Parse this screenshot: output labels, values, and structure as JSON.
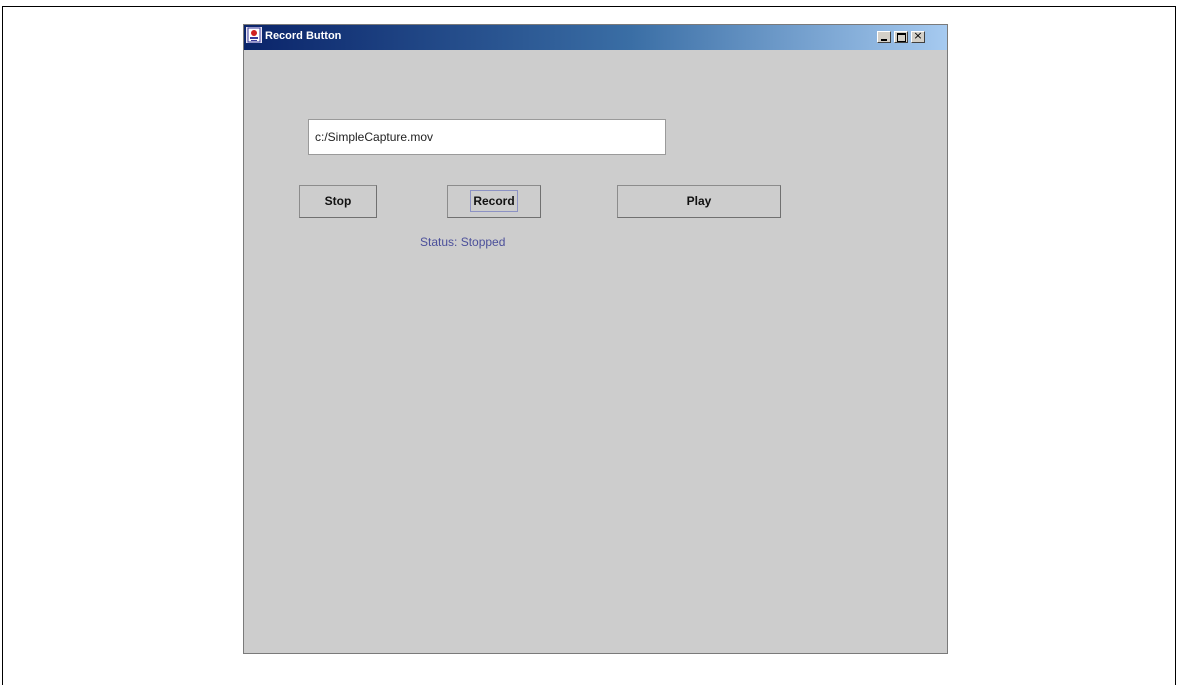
{
  "window": {
    "title": "Record Button"
  },
  "controls": {
    "path_value": "c:/SimpleCapture.mov",
    "stop_label": "Stop",
    "record_label": "Record",
    "play_label": "Play",
    "status_text": "Status: Stopped"
  },
  "icons": {
    "app": "java-app-icon",
    "minimize": "minimize-icon",
    "maximize": "maximize-icon",
    "close": "close-icon"
  },
  "colors": {
    "titlebar_start": "#0a246a",
    "titlebar_end": "#a6caf0",
    "window_bg": "#cdcdcd",
    "status_text": "#4b4f9a"
  }
}
